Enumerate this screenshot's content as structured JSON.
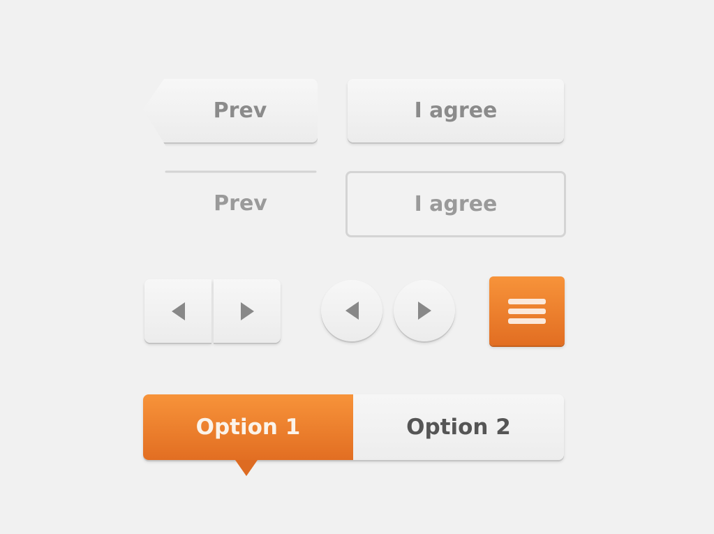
{
  "buttons": {
    "prev_filled": "Prev",
    "agree_filled": "I agree",
    "prev_outline": "Prev",
    "agree_outline": "I agree"
  },
  "icons": {
    "arrow_left": "triangle-left",
    "arrow_right": "triangle-right",
    "menu": "hamburger"
  },
  "segmented": {
    "options": [
      "Option 1",
      "Option 2"
    ],
    "selected": 0
  },
  "colors": {
    "accent": "#f08a30",
    "background": "#f1f1f1",
    "text": "#8b8b8b"
  }
}
